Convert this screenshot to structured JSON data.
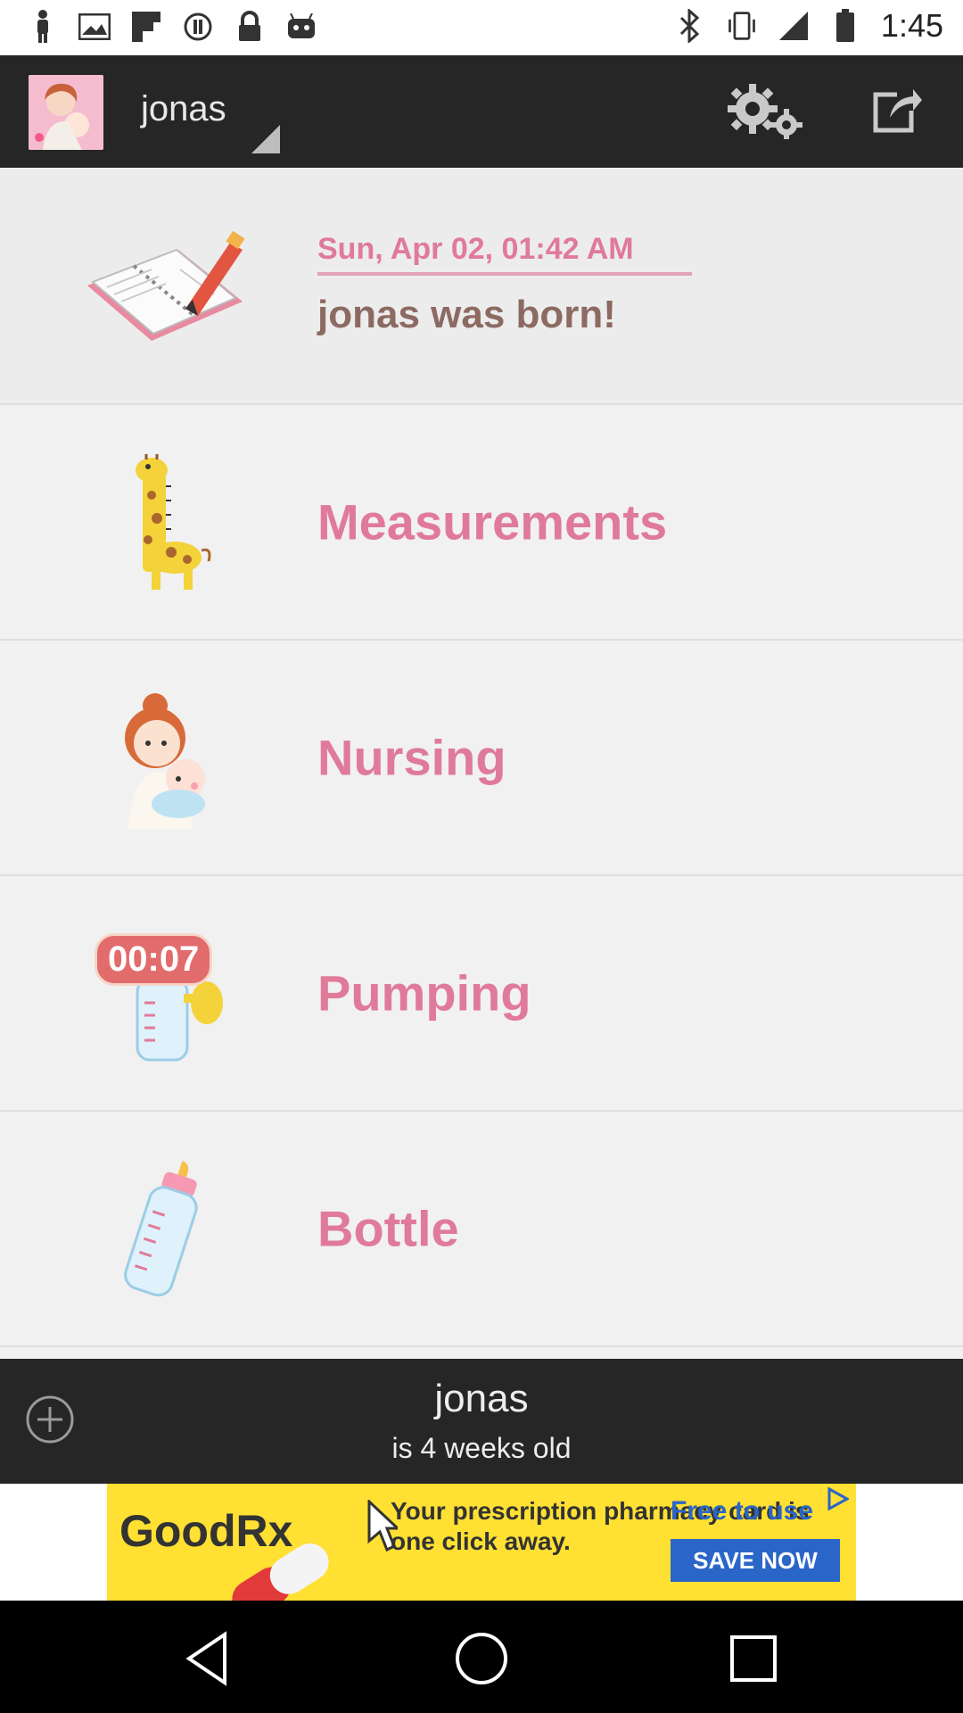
{
  "status_bar": {
    "time": "1:45",
    "left_icons": [
      "person-icon",
      "image-icon",
      "flipboard-icon",
      "record-icon",
      "lock-icon",
      "android-icon"
    ],
    "right_icons": [
      "bluetooth-icon",
      "vibrate-icon",
      "signal-icon",
      "battery-icon"
    ]
  },
  "app_bar": {
    "child_name": "jonas",
    "actions": [
      "settings-icon",
      "share-icon"
    ]
  },
  "event": {
    "date": "Sun, Apr 02, 01:42 AM",
    "text": "jonas was born!"
  },
  "menu": {
    "items": [
      {
        "label": "Measurements",
        "icon": "giraffe-ruler-icon"
      },
      {
        "label": "Nursing",
        "icon": "mother-baby-icon"
      },
      {
        "label": "Pumping",
        "icon": "pump-icon",
        "timer": "00:07"
      },
      {
        "label": "Bottle",
        "icon": "bottle-icon"
      }
    ]
  },
  "footer": {
    "name": "jonas",
    "age": "is 4 weeks old"
  },
  "ad": {
    "brand": "GoodRx",
    "text": "Your prescription pharmacy card is one click away.",
    "free": "Free to use",
    "cta": "SAVE NOW"
  },
  "colors": {
    "accent": "#e07a9a",
    "bar": "#262626",
    "event_text": "#8c6a62"
  }
}
